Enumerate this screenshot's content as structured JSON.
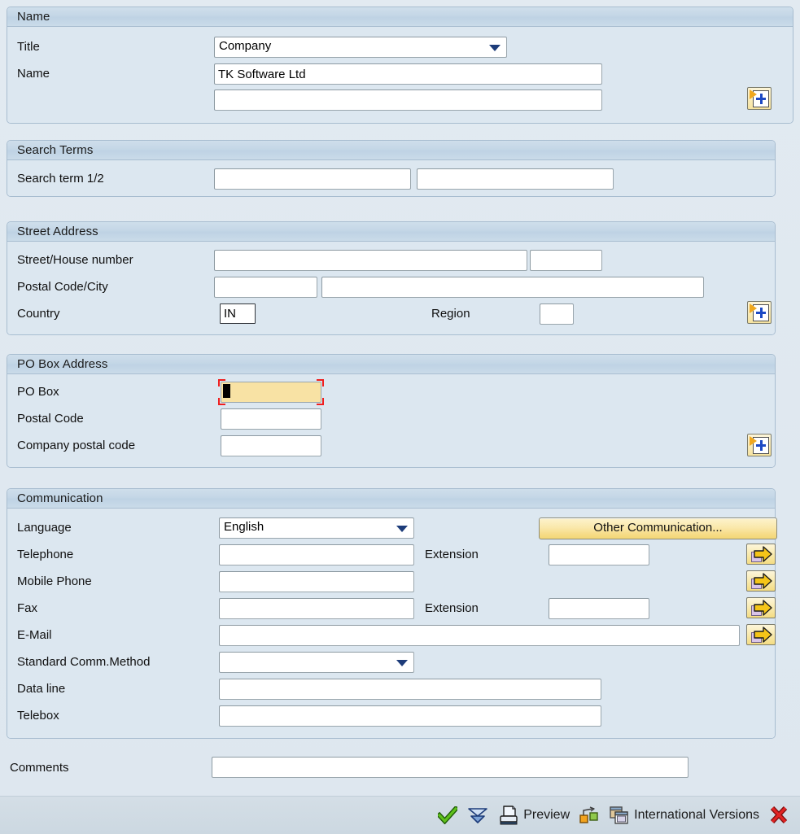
{
  "form": {
    "sections": [
      {
        "id": "name",
        "title": "Name",
        "fields": {
          "title_label": "Title",
          "title_value": "Company",
          "name_label": "Name",
          "name_value": "TK Software Ltd",
          "name_line2_value": ""
        }
      },
      {
        "id": "search_terms",
        "title": "Search Terms",
        "fields": {
          "search_label": "Search term 1/2",
          "search_term_1": "",
          "search_term_2": ""
        }
      },
      {
        "id": "street_address",
        "title": "Street Address",
        "fields": {
          "street_label": "Street/House number",
          "street_value": "",
          "house_number_value": "",
          "postal_city_label": "Postal Code/City",
          "postal_code_value": "",
          "city_value": "",
          "country_label": "Country",
          "country_value": "IN",
          "region_label": "Region",
          "region_value": ""
        }
      },
      {
        "id": "po_box_address",
        "title": "PO Box Address",
        "fields": {
          "po_box_label": "PO Box",
          "po_box_value": "",
          "postal_code_label": "Postal Code",
          "postal_code_value": "",
          "company_postal_label": "Company postal code",
          "company_postal_value": ""
        }
      },
      {
        "id": "communication",
        "title": "Communication",
        "fields": {
          "language_label": "Language",
          "language_value": "English",
          "other_communication_button": "Other Communication...",
          "telephone_label": "Telephone",
          "telephone_value": "",
          "telephone_extension_label": "Extension",
          "telephone_extension_value": "",
          "mobile_label": "Mobile Phone",
          "mobile_value": "",
          "fax_label": "Fax",
          "fax_value": "",
          "fax_extension_label": "Extension",
          "fax_extension_value": "",
          "email_label": "E-Mail",
          "email_value": "",
          "std_comm_label": "Standard Comm.Method",
          "std_comm_value": "",
          "data_line_label": "Data line",
          "data_line_value": "",
          "telebox_label": "Telebox",
          "telebox_value": ""
        }
      }
    ],
    "comments": {
      "label": "Comments",
      "value": ""
    }
  },
  "footer": {
    "continue_icon": "green-check-icon",
    "more_icon": "double-chevron-down-icon",
    "preview_icon": "printer-icon",
    "preview_label": "Preview",
    "relations_icon": "network-nodes-icon",
    "international_versions_icon": "stacked-windows-icon",
    "international_versions_label": "International Versions",
    "cancel_icon": "red-x-icon"
  },
  "colors": {
    "page_background": "#dee7ef",
    "panel_background": "#dce7f0",
    "panel_header": "#c3d6e6",
    "panel_border": "#a8bdd0",
    "focus_field_background": "#f8e2a4",
    "focus_bracket": "#ef1f1f",
    "button_yellow": "#f6db86",
    "dropdown_arrow": "#1d3c7a",
    "footer_background": "#ccd8e1",
    "check_green": "#3fa215",
    "cancel_red": "#d61f1f"
  }
}
